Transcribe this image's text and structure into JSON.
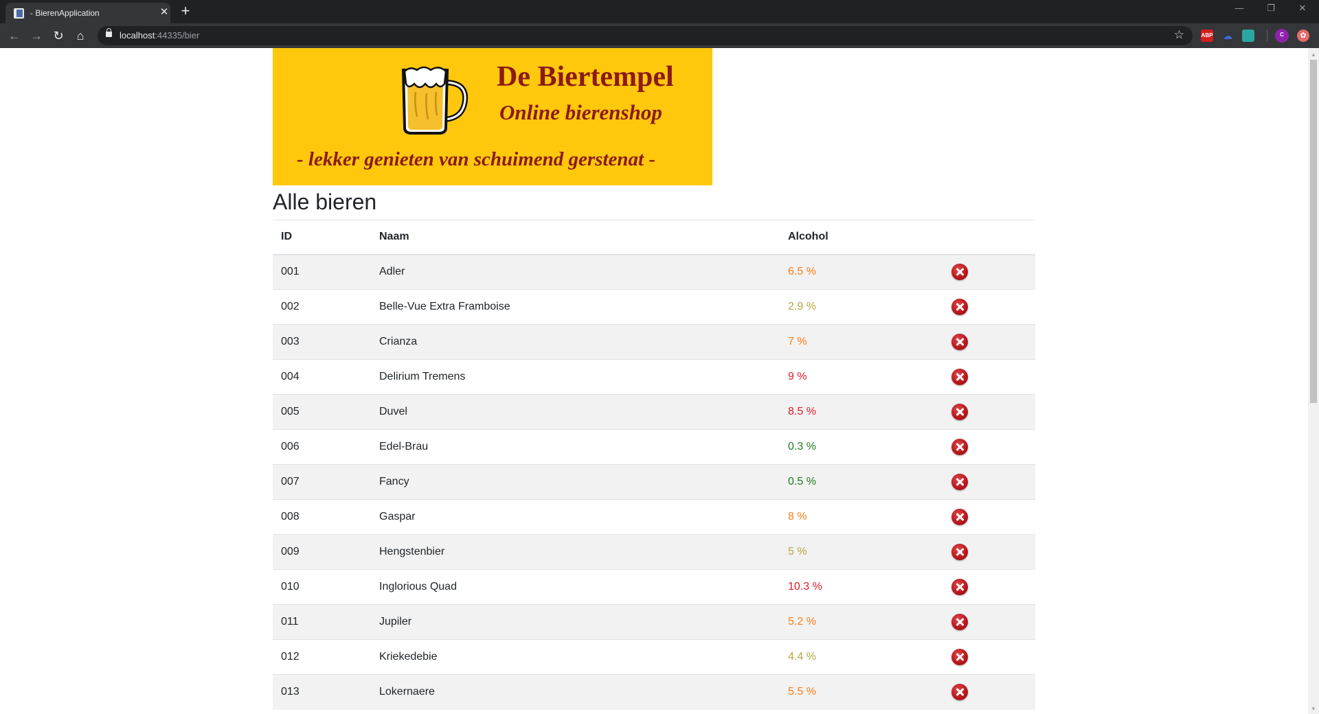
{
  "browser": {
    "tab_title": " - BierenApplication",
    "tab_close": "✕",
    "new_tab": "+",
    "minimize": "—",
    "restore": "❐",
    "close": "✕",
    "url_host": "localhost",
    "url_rest": ":44335/bier",
    "ext_abp": "ABP",
    "profile_initial": "C",
    "icons": [
      "back-icon",
      "forward-icon",
      "reload-icon",
      "home-icon",
      "lock-icon",
      "star-icon"
    ]
  },
  "banner": {
    "title": "De Biertempel",
    "subtitle": "Online bierenshop",
    "tagline": "- lekker genieten van schuimend gerstenat -"
  },
  "page": {
    "heading": "Alle bieren"
  },
  "table": {
    "headers": {
      "id": "ID",
      "naam": "Naam",
      "alcohol": "Alcohol"
    },
    "rows": [
      {
        "id": "001",
        "naam": "Adler",
        "alcohol": "6.5 %",
        "color": "#fd7e14"
      },
      {
        "id": "002",
        "naam": "Belle-Vue Extra Framboise",
        "alcohol": "2.9 %",
        "color": "#b5a642"
      },
      {
        "id": "003",
        "naam": "Crianza",
        "alcohol": "7 %",
        "color": "#fd7e14"
      },
      {
        "id": "004",
        "naam": "Delirium Tremens",
        "alcohol": "9 %",
        "color": "#dc1c28"
      },
      {
        "id": "005",
        "naam": "Duvel",
        "alcohol": "8.5 %",
        "color": "#dc1c28"
      },
      {
        "id": "006",
        "naam": "Edel-Brau",
        "alcohol": "0.3 %",
        "color": "#1e7a1e"
      },
      {
        "id": "007",
        "naam": "Fancy",
        "alcohol": "0.5 %",
        "color": "#1e7a1e"
      },
      {
        "id": "008",
        "naam": "Gaspar",
        "alcohol": "8 %",
        "color": "#fd7e14"
      },
      {
        "id": "009",
        "naam": "Hengstenbier",
        "alcohol": "5 %",
        "color": "#b5a642"
      },
      {
        "id": "010",
        "naam": "Inglorious Quad",
        "alcohol": "10.3 %",
        "color": "#dc1c28"
      },
      {
        "id": "011",
        "naam": "Jupiler",
        "alcohol": "5.2 %",
        "color": "#fd7e14"
      },
      {
        "id": "012",
        "naam": "Kriekedebie",
        "alcohol": "4.4 %",
        "color": "#b5a642"
      },
      {
        "id": "013",
        "naam": "Lokernaere",
        "alcohol": "5.5 %",
        "color": "#fd7e14"
      }
    ]
  }
}
